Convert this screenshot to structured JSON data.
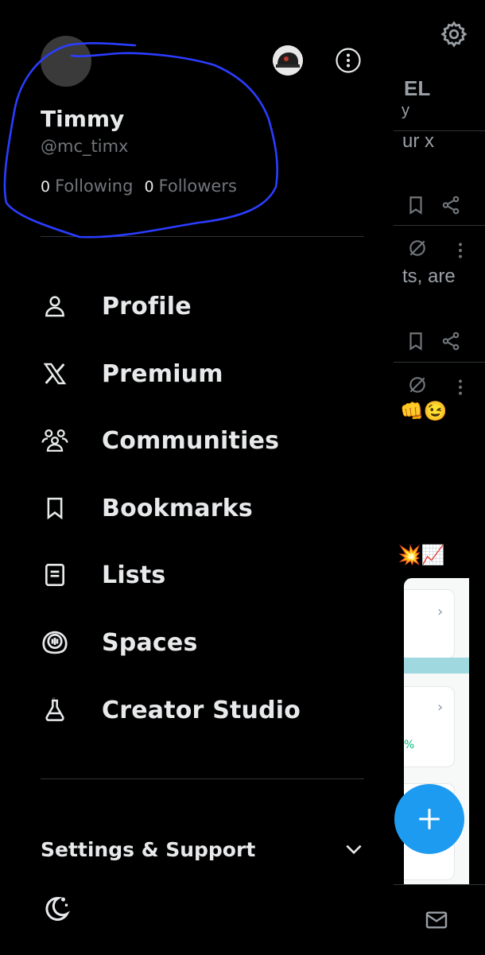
{
  "profile": {
    "name": "Timmy",
    "handle": "@mc_timx",
    "following_count": "0",
    "following_label": "Following",
    "followers_count": "0",
    "followers_label": "Followers"
  },
  "menu": {
    "items": [
      {
        "label": "Profile",
        "icon": "person-icon"
      },
      {
        "label": "Premium",
        "icon": "x-logo-icon"
      },
      {
        "label": "Communities",
        "icon": "communities-icon"
      },
      {
        "label": "Bookmarks",
        "icon": "bookmark-icon"
      },
      {
        "label": "Lists",
        "icon": "list-icon"
      },
      {
        "label": "Spaces",
        "icon": "spaces-icon"
      },
      {
        "label": "Creator Studio",
        "icon": "creator-studio-icon"
      }
    ]
  },
  "footer": {
    "settings_label": "Settings & Support",
    "theme_icon": "moon-icon"
  },
  "feed": {
    "title_fragment": "EL",
    "title_fragment2": "y",
    "text1": "ur x",
    "text2": "ts, are",
    "emoji_row1": "👊😉",
    "emoji_row2": "💥📈",
    "card_pct": "%"
  },
  "colors": {
    "background": "#000000",
    "accent": "#1d9bf0",
    "annotation": "#2b3dff",
    "text_primary": "#e7e9ea",
    "text_secondary": "#71767b"
  }
}
